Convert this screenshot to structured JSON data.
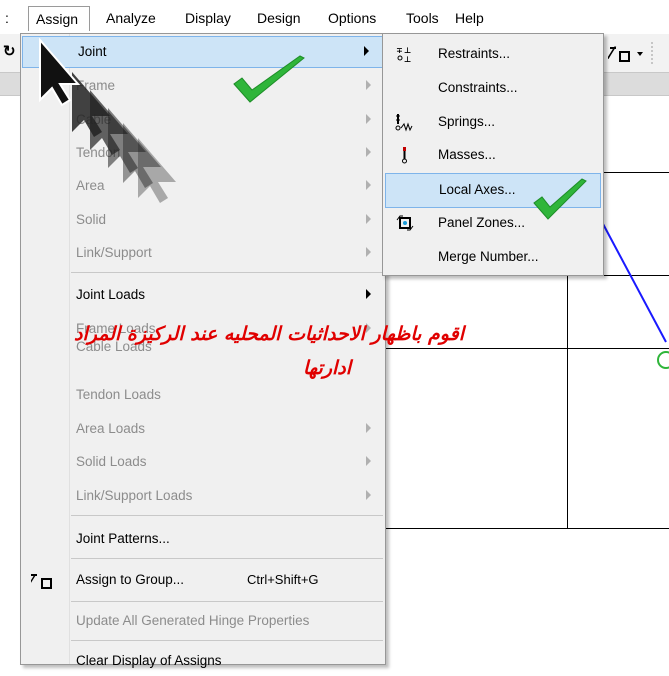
{
  "menubar": {
    "items": [
      {
        "label": "Assign",
        "active": true
      },
      {
        "label": "Analyze"
      },
      {
        "label": "Display"
      },
      {
        "label": "Design"
      },
      {
        "label": "Options"
      },
      {
        "label": "Tools"
      },
      {
        "label": "Help"
      }
    ]
  },
  "assign_menu": {
    "items": [
      {
        "label": "Joint",
        "highlighted": true
      },
      {
        "label": "Frame",
        "disabled": true
      },
      {
        "label": "Cable",
        "disabled": true
      },
      {
        "label": "Tendon",
        "disabled": true
      },
      {
        "label": "Area",
        "disabled": true
      },
      {
        "label": "Solid",
        "disabled": true
      },
      {
        "label": "Link/Support",
        "disabled": true
      },
      {
        "label": "Joint Loads"
      },
      {
        "label": "Frame Loads",
        "disabled": true
      },
      {
        "label": "Cable Loads",
        "disabled": true
      },
      {
        "label": "Tendon Loads",
        "disabled": true
      },
      {
        "label": "Area Loads",
        "disabled": true
      },
      {
        "label": "Solid Loads",
        "disabled": true
      },
      {
        "label": "Link/Support Loads",
        "disabled": true
      },
      {
        "label": "Joint Patterns..."
      },
      {
        "label": "Assign to Group...",
        "shortcut": "Ctrl+Shift+G"
      },
      {
        "label": "Update All Generated Hinge Properties",
        "disabled": true
      },
      {
        "label": "Clear Display of Assigns"
      }
    ]
  },
  "joint_submenu": {
    "items": [
      {
        "label": "Restraints...",
        "icon": "restraints-icon"
      },
      {
        "label": "Constraints..."
      },
      {
        "label": "Springs...",
        "icon": "springs-icon"
      },
      {
        "label": "Masses...",
        "icon": "masses-icon"
      },
      {
        "label": "Local Axes...",
        "highlighted": true
      },
      {
        "label": "Panel Zones...",
        "icon": "panel-zones-icon"
      },
      {
        "label": "Merge Number..."
      }
    ]
  },
  "annotation": {
    "line1": "اقوم باظهار الاحداثيات المحليه عند الركيزة المراد",
    "line2": "ادارتها"
  },
  "colors": {
    "highlight": "#cde4f7",
    "highlight_border": "#7eb4ea",
    "annotation": "#e00000",
    "checkmark": "#2fb53a",
    "model_line": "#1a1aff"
  }
}
